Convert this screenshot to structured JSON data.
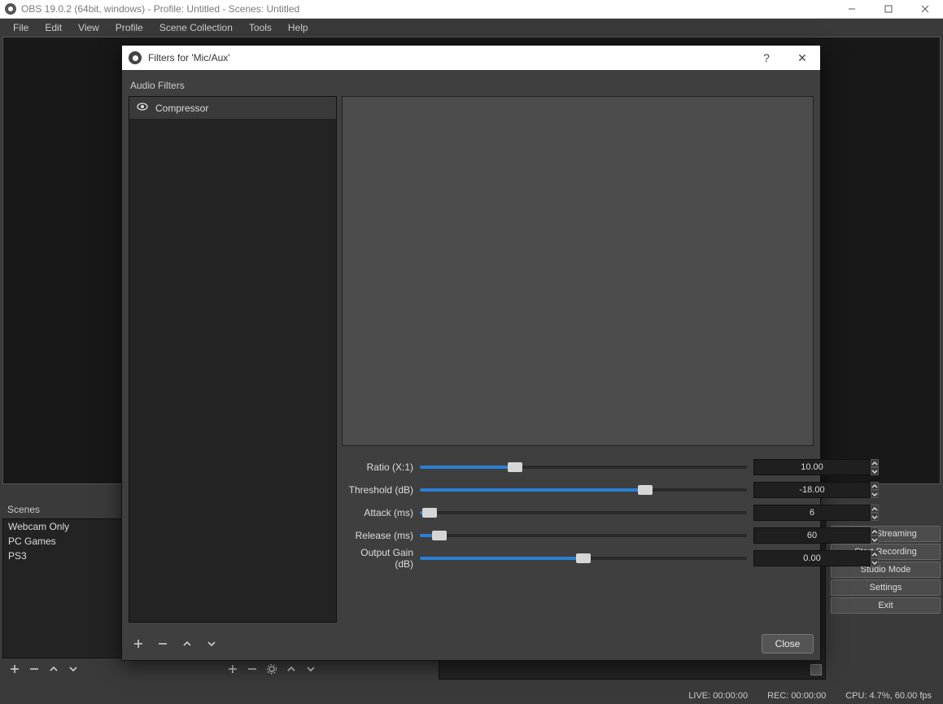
{
  "window": {
    "title": "OBS 19.0.2 (64bit, windows) - Profile: Untitled - Scenes: Untitled"
  },
  "menubar": [
    "File",
    "Edit",
    "View",
    "Profile",
    "Scene Collection",
    "Tools",
    "Help"
  ],
  "scenes": {
    "header": "Scenes",
    "items": [
      "Webcam Only",
      "PC Games",
      "PS3"
    ]
  },
  "controls": {
    "start_streaming": "Start Streaming",
    "start_recording": "Start Recording",
    "studio_mode": "Studio Mode",
    "settings": "Settings",
    "exit": "Exit"
  },
  "statusbar": {
    "live": "LIVE: 00:00:00",
    "rec": "REC: 00:00:00",
    "cpu": "CPU: 4.7%, 60.00 fps"
  },
  "dialog": {
    "title": "Filters for 'Mic/Aux'",
    "audio_filters_label": "Audio Filters",
    "filter_items": [
      "Compressor"
    ],
    "params": [
      {
        "label": "Ratio (X:1)",
        "value": "10.00",
        "fill_pct": 29
      },
      {
        "label": "Threshold (dB)",
        "value": "-18.00",
        "fill_pct": 69
      },
      {
        "label": "Attack (ms)",
        "value": "6",
        "fill_pct": 3
      },
      {
        "label": "Release (ms)",
        "value": "60",
        "fill_pct": 6
      },
      {
        "label": "Output Gain (dB)",
        "value": "0.00",
        "fill_pct": 50
      }
    ],
    "close_label": "Close"
  },
  "icons": {
    "plus": "plus-icon",
    "minus": "minus-icon",
    "up": "chevron-up-icon",
    "down": "chevron-down-icon",
    "gear": "gear-icon",
    "eye": "eye-icon",
    "help": "?",
    "close_x": "✕"
  }
}
